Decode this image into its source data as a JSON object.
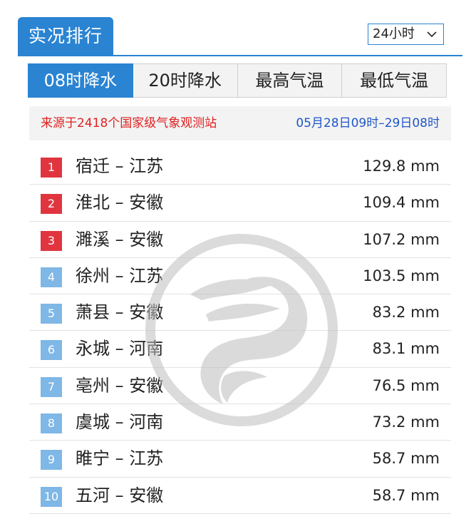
{
  "panel": {
    "title": "实况排行",
    "period": {
      "selected": "24小时"
    }
  },
  "tabs": [
    {
      "label": "08时降水",
      "active": true
    },
    {
      "label": "20时降水",
      "active": false
    },
    {
      "label": "最高气温",
      "active": false
    },
    {
      "label": "最低气温",
      "active": false
    }
  ],
  "info": {
    "source": "来源于2418个国家级气象观测站",
    "time_range": "05月28日09时–29日08时"
  },
  "ranking": [
    {
      "rank": "1",
      "station": "宿迁 – 江苏",
      "value": "129.8 mm"
    },
    {
      "rank": "2",
      "station": "淮北 – 安徽",
      "value": "109.4 mm"
    },
    {
      "rank": "3",
      "station": "濉溪 – 安徽",
      "value": "107.2 mm"
    },
    {
      "rank": "4",
      "station": "徐州 – 江苏",
      "value": "103.5 mm"
    },
    {
      "rank": "5",
      "station": "萧县 – 安徽",
      "value": "83.2 mm"
    },
    {
      "rank": "6",
      "station": "永城 – 河南",
      "value": "83.1 mm"
    },
    {
      "rank": "7",
      "station": "亳州 – 安徽",
      "value": "76.5 mm"
    },
    {
      "rank": "8",
      "station": "虞城 – 河南",
      "value": "73.2 mm"
    },
    {
      "rank": "9",
      "station": "睢宁 – 江苏",
      "value": "58.7 mm"
    },
    {
      "rank": "10",
      "station": "五河 – 安徽",
      "value": "58.7 mm"
    }
  ],
  "colors": {
    "accent": "#2a84d2",
    "rank_top": "#e0353f",
    "rank_rest": "#7fb7e6",
    "source_text": "#e02020",
    "time_text": "#2056c8"
  },
  "icons": {
    "dropdown": "chevron-down-icon",
    "watermark": "weather-logo-watermark"
  }
}
